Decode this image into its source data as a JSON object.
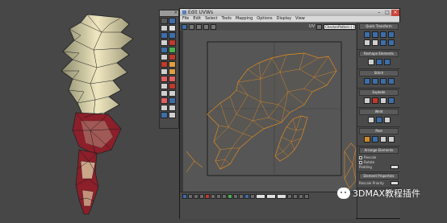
{
  "toolbar": {
    "close_glyph": "×"
  },
  "window": {
    "title": "Edit UVWs",
    "minimize_glyph": "–",
    "maximize_glyph": "□",
    "close_glyph": "×"
  },
  "menu": {
    "items": [
      "File",
      "Edit",
      "Select",
      "Tools",
      "Mapping",
      "Options",
      "Display",
      "View"
    ]
  },
  "topbar": {
    "uv_label": "UV",
    "checker_value": "CheckerPattern ( Checker )"
  },
  "panel": {
    "rollouts": [
      {
        "title": "Quick Transform"
      },
      {
        "title": "Reshape Elements"
      },
      {
        "title": "Stitch"
      },
      {
        "title": "Explode"
      },
      {
        "title": "Weld"
      },
      {
        "title": "Peel"
      },
      {
        "title": "Arrange Elements"
      },
      {
        "title": "Element Properties"
      }
    ],
    "arrange": {
      "rescale": "Rescale",
      "rotate": "Rotate",
      "padding": "Padding"
    },
    "element_props": {
      "rescale_priority": "Rescale Priority"
    }
  },
  "bottom": {
    "xy_label": "XY"
  },
  "watermark": {
    "text": "3DMAX教程插件"
  },
  "colors": {
    "uv_seam": "#e38a1f",
    "mesh_wire": "#1a1a1a",
    "blade_cream": "#e8dfb2",
    "blade_red": "#8c1f2a",
    "canvas_bg": "#565656",
    "border_line": "#1e1e1e"
  }
}
